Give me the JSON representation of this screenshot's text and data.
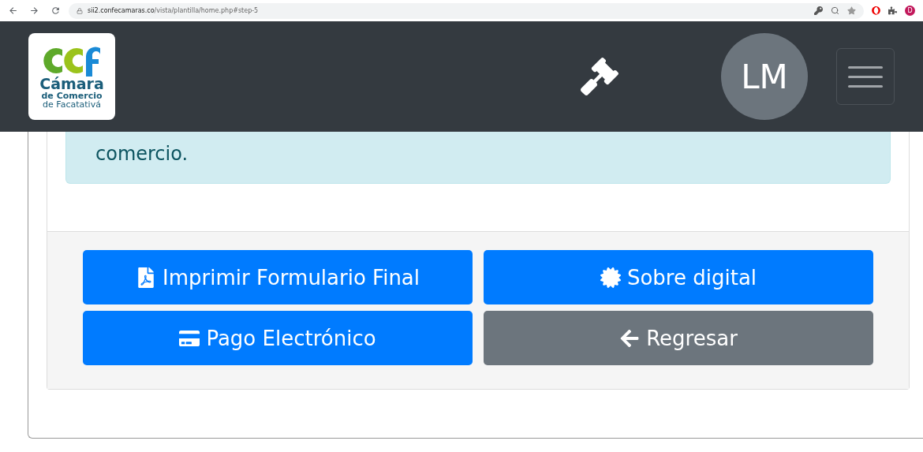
{
  "browser": {
    "url_host": "sii2.confecamaras.co",
    "url_path": "/vista/plantilla/home.php#step-5",
    "profile": "D"
  },
  "navbar": {
    "logo": {
      "title": "Cámara",
      "line_2": "de Comercio",
      "line_3": "de Facatativá"
    },
    "avatar": "LM"
  },
  "alert": {
    "text": "comercio."
  },
  "buttons": [
    {
      "label": "Imprimir Formulario Final",
      "kind": "pdf"
    },
    {
      "label": "Sobre digital",
      "kind": "seal"
    },
    {
      "label": "Pago Electrónico",
      "kind": "card"
    },
    {
      "label": "Regresar",
      "kind": "back"
    }
  ]
}
